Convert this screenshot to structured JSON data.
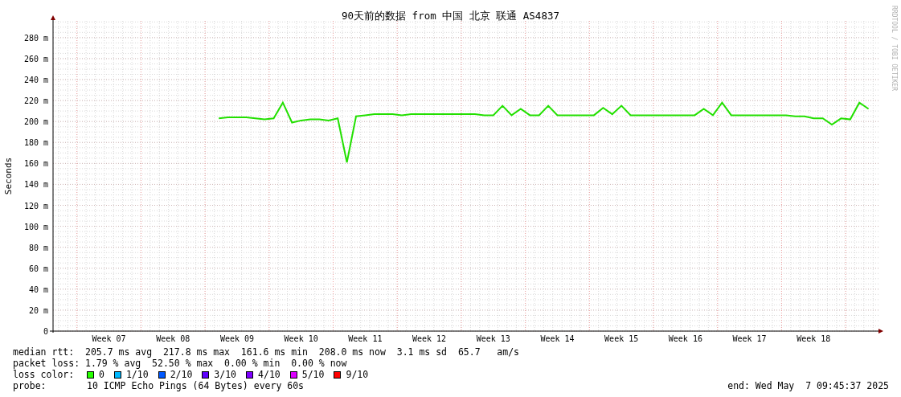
{
  "title": "90天前的数据 from 中国 北京 联通 AS4837",
  "watermark_text": "RRDTOOL / TOBI OETIKER",
  "chart_data": {
    "type": "line",
    "grid": true,
    "ylabel": "Seconds",
    "ylim": [
      0,
      296
    ],
    "categories": [
      null,
      null,
      null,
      null,
      null,
      null,
      "Week 07",
      null,
      null,
      null,
      null,
      null,
      null,
      "Week 08",
      null,
      null,
      null,
      null,
      null,
      null,
      "Week 09",
      null,
      null,
      null,
      null,
      null,
      null,
      "Week 10",
      null,
      null,
      null,
      null,
      null,
      null,
      "Week 11",
      null,
      null,
      null,
      null,
      null,
      null,
      "Week 12",
      null,
      null,
      null,
      null,
      null,
      null,
      "Week 13",
      null,
      null,
      null,
      null,
      null,
      null,
      "Week 14",
      null,
      null,
      null,
      null,
      null,
      null,
      "Week 15",
      null,
      null,
      null,
      null,
      null,
      null,
      "Week 16",
      null,
      null,
      null,
      null,
      null,
      null,
      "Week 17",
      null,
      null,
      null,
      null,
      null,
      null,
      "Week 18",
      null,
      null,
      null,
      null,
      null,
      null
    ],
    "yticks": [
      {
        "value": 0,
        "label": "0"
      },
      {
        "value": 20,
        "label": "20 m"
      },
      {
        "value": 40,
        "label": "40 m"
      },
      {
        "value": 60,
        "label": "60 m"
      },
      {
        "value": 80,
        "label": "80 m"
      },
      {
        "value": 100,
        "label": "100 m"
      },
      {
        "value": 120,
        "label": "120 m"
      },
      {
        "value": 140,
        "label": "140 m"
      },
      {
        "value": 160,
        "label": "160 m"
      },
      {
        "value": 180,
        "label": "180 m"
      },
      {
        "value": 200,
        "label": "200 m"
      },
      {
        "value": 220,
        "label": "220 m"
      },
      {
        "value": 240,
        "label": "240 m"
      },
      {
        "value": 260,
        "label": "260 m"
      },
      {
        "value": 280,
        "label": "280 m"
      }
    ],
    "series": [
      {
        "color": "#22e000",
        "values": [
          null,
          null,
          null,
          null,
          null,
          null,
          null,
          null,
          null,
          null,
          null,
          null,
          null,
          null,
          null,
          null,
          null,
          null,
          203,
          204,
          204,
          204,
          203,
          202,
          203,
          218,
          199,
          201,
          202,
          202,
          201,
          203,
          161,
          205,
          206,
          207,
          207,
          207,
          206,
          207,
          207,
          207,
          207,
          207,
          207,
          207,
          207,
          206,
          206,
          215,
          206,
          212,
          206,
          206,
          215,
          206,
          206,
          206,
          206,
          206,
          213,
          207,
          215,
          206,
          206,
          206,
          206,
          206,
          206,
          206,
          206,
          212,
          206,
          218,
          206,
          206,
          206,
          206,
          206,
          206,
          206,
          205,
          205,
          203,
          203,
          197,
          203,
          202,
          218,
          212
        ]
      }
    ]
  },
  "legend": {
    "median_rtt": "median rtt:  205.7 ms avg  217.8 ms max  161.6 ms min  208.0 ms now  3.1 ms sd  65.7   am/s",
    "packet_loss": "packet loss: 1.79 % avg  52.50 % max  0.00 % min  0.00 % now",
    "loss_color_label": "loss color:",
    "loss_colors": [
      {
        "label": "0",
        "color": "#26ff00"
      },
      {
        "label": "1/10",
        "color": "#00b8ff"
      },
      {
        "label": "2/10",
        "color": "#0059ff"
      },
      {
        "label": "3/10",
        "color": "#5e00ff"
      },
      {
        "label": "4/10",
        "color": "#7e00ff"
      },
      {
        "label": "5/10",
        "color": "#dd00ff"
      },
      {
        "label": "9/10",
        "color": "#ff0000"
      }
    ],
    "probe_label": "probe:",
    "probe": "10 ICMP Echo Pings (64 Bytes) every 60s",
    "end": "end: Wed May  7 09:45:37 2025"
  }
}
